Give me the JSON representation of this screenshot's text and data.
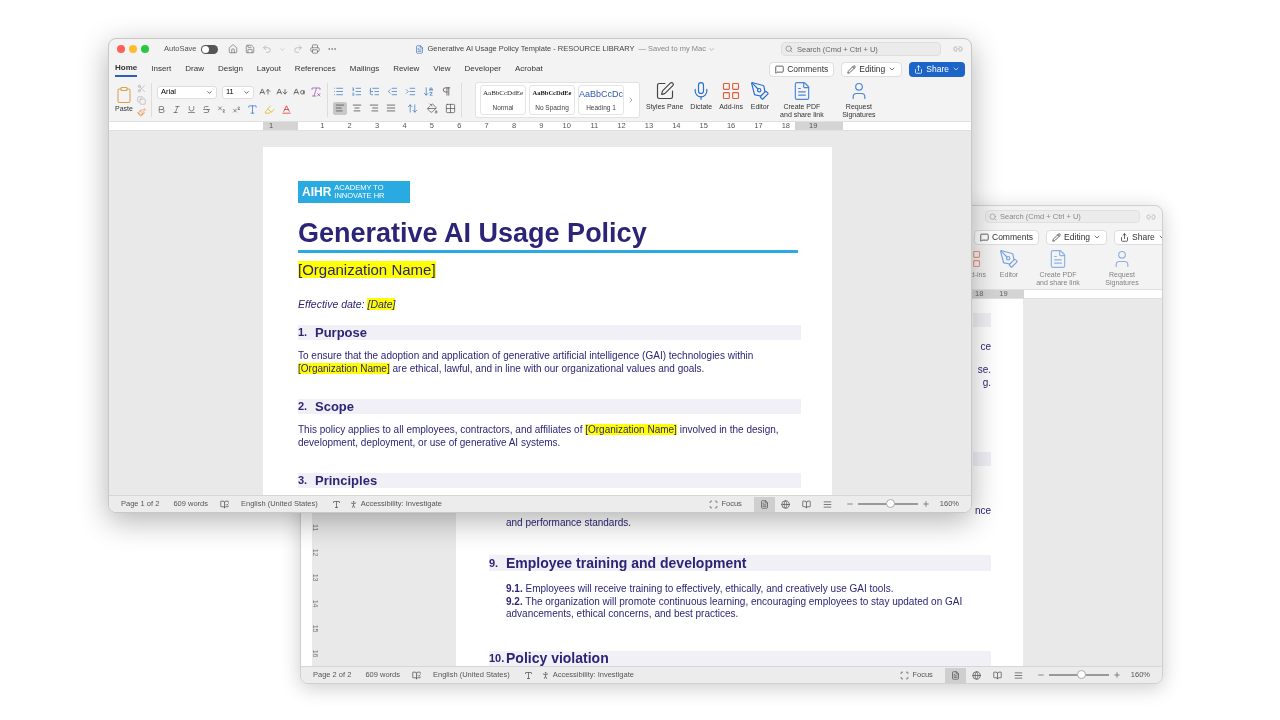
{
  "front_window": {
    "title_bar": {
      "autosave_label": "AutoSave",
      "autosave_on": false,
      "title": "Generative AI Usage Policy Template - RESOURCE LIBRARY",
      "save_status": "— Saved to my Mac",
      "search_placeholder": "Search (Cmd + Ctrl + U)"
    },
    "ribbon_tabs": [
      {
        "label": "Home",
        "selected": true
      },
      {
        "label": "Insert",
        "selected": false
      },
      {
        "label": "Draw",
        "selected": false
      },
      {
        "label": "Design",
        "selected": false
      },
      {
        "label": "Layout",
        "selected": false
      },
      {
        "label": "References",
        "selected": false
      },
      {
        "label": "Mailings",
        "selected": false
      },
      {
        "label": "Review",
        "selected": false
      },
      {
        "label": "View",
        "selected": false
      },
      {
        "label": "Developer",
        "selected": false
      },
      {
        "label": "Acrobat",
        "selected": false
      }
    ],
    "ribbon_buttons": [
      {
        "label": "Comments",
        "kind": "comments"
      },
      {
        "label": "Editing",
        "kind": "editing"
      },
      {
        "label": "Share",
        "kind": "share_active"
      }
    ],
    "ribbon": {
      "paste_label": "Paste",
      "font": "Arial",
      "font_size": "11",
      "alignment": [
        {
          "kind": "left",
          "selected": true
        },
        {
          "kind": "center",
          "selected": false
        },
        {
          "kind": "right",
          "selected": false
        },
        {
          "kind": "justify",
          "selected": false
        }
      ],
      "styles": [
        {
          "preview": "AaBbCcDdEe",
          "name": "Normal",
          "kind": "normal"
        },
        {
          "preview": "AaBbCcDdEe",
          "name": "No Spacing",
          "kind": "nospacing"
        },
        {
          "preview": "AaBbCcDc",
          "name": "Heading 1",
          "kind": "heading"
        }
      ],
      "tools": [
        {
          "label": "Styles Pane",
          "kind": "styles"
        },
        {
          "label": "Dictate",
          "kind": "dictate"
        },
        {
          "label": "Add-ins",
          "kind": "addins"
        },
        {
          "label": "Editor",
          "kind": "editor"
        },
        {
          "label": "Create PDF and share link",
          "kind": "pdf"
        },
        {
          "label": "Request Signatures",
          "kind": "signatures"
        }
      ]
    },
    "ruler_labels": [
      "1",
      "1",
      "2",
      "3",
      "4",
      "5",
      "6",
      "7",
      "8",
      "9",
      "10",
      "11",
      "12",
      "13",
      "14",
      "15",
      "16",
      "17",
      "18",
      "19"
    ],
    "document": {
      "logo": {
        "mark": "AIHR",
        "tagline": "ACADEMY TO INNOVATE HR"
      },
      "title": "Generative AI Usage Policy",
      "organization": "[Organization Name]",
      "effective_label": "Effective date:",
      "effective_value": "[Date]",
      "sections": [
        {
          "number": "1.",
          "heading": "Purpose",
          "body": [
            {
              "text": "To ensure that the adoption and application of generative artificial intelligence (GAI) technologies within ",
              "highlight": false
            },
            {
              "text": "[Organization Name]",
              "highlight": true
            },
            {
              "text": " are ethical, lawful, and in line with our organizational values and goals.",
              "highlight": false
            }
          ]
        },
        {
          "number": "2.",
          "heading": "Scope",
          "body": [
            {
              "text": "This policy applies to all employees, contractors, and affiliates of ",
              "highlight": false
            },
            {
              "text": "[Organization Name]",
              "highlight": true
            },
            {
              "text": " involved in the design, development, deployment, or use of generative AI systems.",
              "highlight": false
            }
          ]
        },
        {
          "number": "3.",
          "heading": "Principles"
        }
      ]
    },
    "status_bar": {
      "page": "Page 1 of 2",
      "words": "609 words",
      "language": "English (United States)",
      "accessibility": "Accessibility: Investigate",
      "focus": "Focus",
      "views": [
        {
          "kind": "print",
          "selected": true
        },
        {
          "kind": "web",
          "selected": false
        },
        {
          "kind": "read",
          "selected": false
        },
        {
          "kind": "outline",
          "selected": false
        }
      ],
      "zoom_slider": {
        "level": 0.54
      },
      "zoom": "160%"
    }
  },
  "back_window": {
    "search_placeholder": "Search (Cmd + Ctrl + U)",
    "ribbon_buttons": [
      {
        "label": "Comments",
        "kind": "comments"
      },
      {
        "label": "Editing",
        "kind": "editing"
      },
      {
        "label": "Share",
        "kind": "share"
      }
    ],
    "tools": [
      {
        "label": "d-ins",
        "kind": "addins"
      },
      {
        "label": "Editor",
        "kind": "editor"
      },
      {
        "label": "Create PDF and share link",
        "kind": "pdf"
      },
      {
        "label": "Request Signatures",
        "kind": "signatures"
      }
    ],
    "ruler_labels": [
      "18",
      "19"
    ],
    "vertical_ruler_labels": [
      "11",
      "12",
      "13",
      "14",
      "15",
      "16"
    ],
    "document": {
      "upper_fragments": [
        "ce",
        "se.",
        "g."
      ],
      "tail_fragment": "nce",
      "continued_line": "and performance standards.",
      "sections": [
        {
          "number": "9.",
          "heading": "Employee training and development",
          "items": [
            "**9.1.** Employees will receive training to effectively, ethically, and creatively use GAI tools.",
            "**9.2.** The organization will promote continuous learning, encouraging employees to stay updated on GAI advancements, ethical concerns, and best practices."
          ]
        },
        {
          "number": "10.",
          "heading": "Policy violation"
        }
      ]
    },
    "status_bar": {
      "page": "Page 2 of 2",
      "words": "609 words",
      "language": "English (United States)",
      "accessibility": "Accessibility: Investigate",
      "focus": "Focus",
      "views": [
        {
          "kind": "print",
          "selected": true
        },
        {
          "kind": "web",
          "selected": false
        },
        {
          "kind": "read",
          "selected": false
        },
        {
          "kind": "outline",
          "selected": false
        }
      ],
      "zoom_slider": {
        "level": 0.54
      },
      "zoom": "160%"
    }
  }
}
